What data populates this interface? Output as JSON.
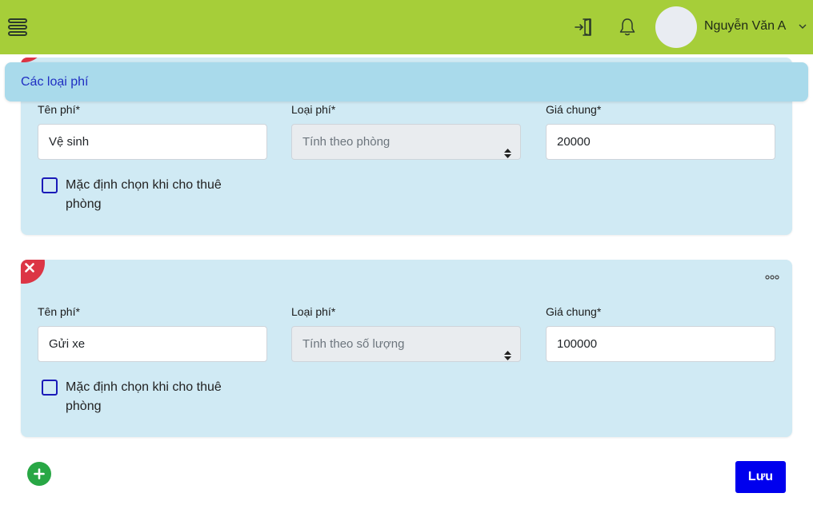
{
  "header": {
    "menu_icon": "hamburger-icon",
    "logout_icon": "door-exit-icon",
    "notification_icon": "bell-icon",
    "user_name": "Nguyễn Văn A",
    "chevron_icon": "chevron-down-icon",
    "background_color": "#a6ce39"
  },
  "section": {
    "title": "Các loại phí"
  },
  "fees": [
    {
      "name_label": "Tên phí*",
      "name_value": "Vệ sinh",
      "type_label": "Loại phí*",
      "type_value": "Tính theo phòng",
      "price_label": "Giá chung*",
      "price_value": "20000",
      "default_checkbox_label": "Mặc định chọn khi cho thuê phòng",
      "default_checked": false
    },
    {
      "name_label": "Tên phí*",
      "name_value": "Gửi xe",
      "type_label": "Loại phí*",
      "type_value": "Tính theo số lượng",
      "price_label": "Giá chung*",
      "price_value": "100000",
      "default_checkbox_label": "Mặc định chọn khi cho thuê phòng",
      "default_checked": false
    }
  ],
  "actions": {
    "add_icon": "plus-circle-icon",
    "delete_icon": "close-icon",
    "more_icon": "more-dots-icon",
    "save_label": "Lưu"
  },
  "colors": {
    "card_background": "#d0eaf4",
    "section_bar": "#a9daeb",
    "delete_red": "#dc3545",
    "add_green": "#28a745",
    "save_blue": "#0000ee"
  }
}
